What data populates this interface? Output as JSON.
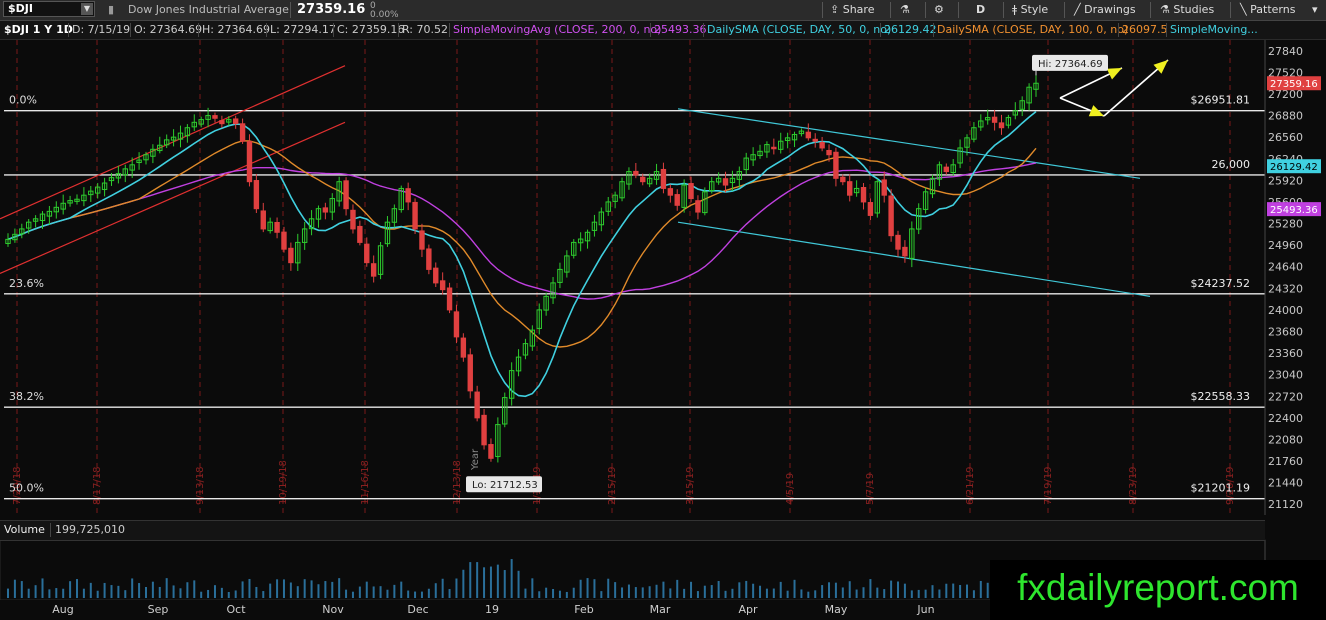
{
  "toolbar": {
    "symbol": "$DJI",
    "name": "Dow Jones Industrial Average",
    "last": "27359.16",
    "change": "0",
    "change_pct": "0.00%",
    "share": "Share",
    "period": "D",
    "style": "Style",
    "drawings": "Drawings",
    "studies": "Studies",
    "patterns": "Patterns"
  },
  "header": {
    "symbol_period": "$DJI 1 Y 1D",
    "date": "D: 7/15/19",
    "open": "O: 27364.69",
    "high": "H: 27364.69",
    "low": "L: 27294.17",
    "close": "C: 27359.16",
    "range": "R: 70.52",
    "sma200_label": "SimpleMovingAvg (CLOSE, 200, 0, no)",
    "sma200_value": "25493.36",
    "sma50_label": "DailySMA (CLOSE, DAY, 50, 0, no)",
    "sma50_value": "26129.42",
    "sma100_label": "DailySMA (CLOSE, DAY, 100, 0, no)",
    "sma100_value": "26097.5",
    "sma_more": "SimpleMoving..."
  },
  "colors": {
    "up": "#2ecc2e",
    "down": "#e04040",
    "sma50": "#40d0e0",
    "sma100": "#e08a2a",
    "sma200": "#c040e0",
    "channel": "#e03030",
    "trend": "#40c8d8",
    "level": "#e8e8e8",
    "arrow": "#f0f020",
    "accent_sma100_text": "#f09030"
  },
  "volume": {
    "label": "Volume",
    "value": "199,725,010"
  },
  "watermark": "fxdailyreport.com",
  "chart_data": {
    "type": "candlestick",
    "title": "$DJI 1 Y 1D",
    "ylim": [
      20960,
      28000
    ],
    "y_ticks": [
      27840,
      27520,
      27200,
      26880,
      26560,
      26240,
      25920,
      25600,
      25280,
      24960,
      24640,
      24320,
      24000,
      23680,
      23360,
      23040,
      22720,
      22400,
      22080,
      21760,
      21440,
      21120
    ],
    "x_labels": [
      "Aug",
      "Sep",
      "Oct",
      "Nov",
      "Dec",
      "19",
      "Feb",
      "Mar",
      "Apr",
      "May",
      "Jun"
    ],
    "date_markers": [
      "7/20/18",
      "8/17/18",
      "9/13/18",
      "10/19/18",
      "11/16/18",
      "12/13/18",
      "1/11/19",
      "2/15/19",
      "3/15/19",
      "4/5/19",
      "5/7/19",
      "6/21/19",
      "7/19/19",
      "8/23/19",
      "9/20/19"
    ],
    "year_marker": "Year",
    "closes": [
      25045,
      25120,
      25200,
      25300,
      25350,
      25420,
      25460,
      25520,
      25580,
      25620,
      25640,
      25700,
      25760,
      25820,
      25880,
      25960,
      26020,
      26090,
      26150,
      26220,
      26300,
      26380,
      26440,
      26520,
      26560,
      26620,
      26700,
      26780,
      26820,
      26880,
      26840,
      26760,
      26820,
      26760,
      26500,
      25900,
      25500,
      25200,
      25300,
      25150,
      24900,
      24700,
      25000,
      25200,
      25350,
      25500,
      25450,
      25650,
      25900,
      25500,
      25200,
      25000,
      24700,
      24500,
      24950,
      25300,
      25500,
      25800,
      25600,
      25200,
      24900,
      24600,
      24400,
      24300,
      24000,
      23600,
      23300,
      22800,
      22400,
      22000,
      21800,
      22300,
      22700,
      23100,
      23300,
      23500,
      23700,
      24000,
      24200,
      24400,
      24600,
      24800,
      25000,
      25050,
      25150,
      25300,
      25450,
      25600,
      25700,
      25900,
      26050,
      26000,
      25900,
      25950,
      26050,
      25800,
      25700,
      25550,
      25850,
      25650,
      25450,
      25750,
      25900,
      25950,
      25850,
      25950,
      26050,
      26250,
      26300,
      26350,
      26450,
      26400,
      26500,
      26550,
      26600,
      26650,
      26550,
      26500,
      26400,
      26300,
      25950,
      25900,
      25700,
      25800,
      25600,
      25400,
      25900,
      25700,
      25100,
      24900,
      24800,
      25200,
      25500,
      25750,
      25950,
      26150,
      26050,
      26150,
      26400,
      26550,
      26700,
      26800,
      26850,
      26780,
      26700,
      26850,
      26950,
      27100,
      27300,
      27359
    ],
    "levels": [
      {
        "label": "0.0%",
        "value": "$26951.81",
        "y": 26951.81
      },
      {
        "label": "",
        "value": "26,000",
        "y": 26000
      },
      {
        "label": "23.6%",
        "value": "$24237.52",
        "y": 24237.52
      },
      {
        "label": "38.2%",
        "value": "$22558.33",
        "y": 22558.33
      },
      {
        "label": "50.0%",
        "value": "$21201.19",
        "y": 21201.19
      }
    ],
    "price_tags": [
      {
        "text": "27359.16",
        "y": 27359.16,
        "color": "#e04040"
      },
      {
        "text": "26129.42",
        "y": 26129.42,
        "color": "#40d0e0"
      },
      {
        "text": "25493.36",
        "y": 25493.36,
        "color": "#c040e0"
      }
    ],
    "annotations": {
      "high": "Hi: 27364.69",
      "low": "Lo: 21712.53"
    }
  }
}
